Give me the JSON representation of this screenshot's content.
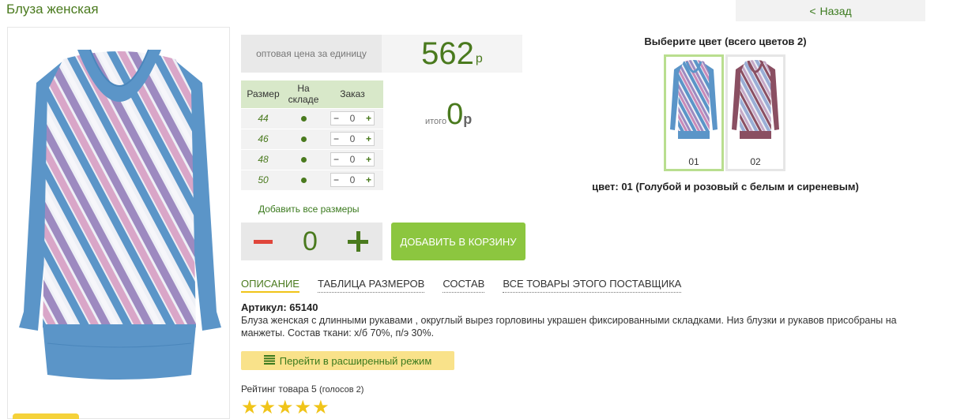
{
  "title": "Блуза женская",
  "back": {
    "arrow": "<",
    "label": "Назад"
  },
  "price": {
    "label": "оптовая цена за единицу",
    "value": "562",
    "currency": "р"
  },
  "sizes": {
    "headers": {
      "size": "Размер",
      "stock": "На складе",
      "order": "Заказ"
    },
    "rows": [
      {
        "size": "44",
        "qty": "0"
      },
      {
        "size": "46",
        "qty": "0"
      },
      {
        "size": "48",
        "qty": "0"
      },
      {
        "size": "50",
        "qty": "0"
      }
    ],
    "minus": "−",
    "plus": "+"
  },
  "total": {
    "label": "итого",
    "value": "0",
    "currency": "р"
  },
  "add_all_sizes": "Добавить все размеры",
  "quantity": {
    "value": "0"
  },
  "cart_button": "ДОБАВИТЬ В КОРЗИНУ",
  "tabs": [
    {
      "label": "ОПИСАНИЕ",
      "active": true
    },
    {
      "label": "ТАБЛИЦА РАЗМЕРОВ"
    },
    {
      "label": "СОСТАВ"
    },
    {
      "label": "ВСЕ ТОВАРЫ ЭТОГО ПОСТАВЩИКА"
    }
  ],
  "article": "Артикул: 65140",
  "description": "Блуза женская с длинными рукавами , округлый вырез горловины украшен фиксированными складками. Низ блузки и рукавов присобраны на манжеты. Состав ткани: х/б 70%, п/э 30%.",
  "extended_mode": "Перейти в расширенный режим",
  "rating": {
    "label": "Рейтинг товара 5",
    "votes": "(голосов 2)",
    "stars": 5,
    "max": 5
  },
  "colors": {
    "title": "Выберите цвет (всего цветов 2)",
    "swatches": [
      {
        "code": "01",
        "selected": true,
        "sleeve": "#5b95c8",
        "stripe": "#c98ab8"
      },
      {
        "code": "02",
        "selected": false,
        "sleeve": "#8a4f62",
        "stripe": "#9aaed6"
      }
    ],
    "selected_name": "цвет: 01 (Голубой и розовый с белым и сиреневым)"
  },
  "palette": {
    "accent_green": "#4a7a1e",
    "button_green": "#8cc63f",
    "minus_red": "#e0463b",
    "star_yellow": "#f0c419"
  }
}
